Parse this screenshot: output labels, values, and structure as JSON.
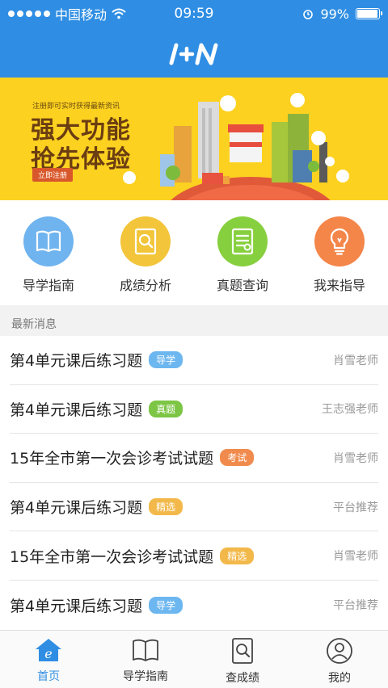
{
  "status_bar": {
    "carrier": "中国移动",
    "time": "09:59",
    "battery": "99%",
    "battery_level": 0.99
  },
  "header": {
    "logo_text": "I+N"
  },
  "banner": {
    "subtitle": "注册即可实时获得最新资讯",
    "line1": "强大功能",
    "line2": "抢先体验",
    "cta": "立即注册"
  },
  "quick_nav": [
    {
      "label": "导学指南",
      "icon": "book-icon",
      "color": "#6fb3ef"
    },
    {
      "label": "成绩分析",
      "icon": "magnifier-doc-icon",
      "color": "#f2c53a"
    },
    {
      "label": "真题查询",
      "icon": "document-list-icon",
      "color": "#86cf3e"
    },
    {
      "label": "我来指导",
      "icon": "lightbulb-icon",
      "color": "#f4864a"
    }
  ],
  "news": {
    "title": "最新消息",
    "items": [
      {
        "text": "第4单元课后练习题",
        "tag": "导学",
        "tag_color": "#6db7f0",
        "source": "肖雪老师"
      },
      {
        "text": "第4单元课后练习题",
        "tag": "真题",
        "tag_color": "#7cc545",
        "source": "王志强老师"
      },
      {
        "text": "15年全市第一次会诊考试试题",
        "tag": "考试",
        "tag_color": "#f08b4d",
        "source": "肖雪老师"
      },
      {
        "text": "第4单元课后练习题",
        "tag": "精选",
        "tag_color": "#f2b84a",
        "source": "平台推荐"
      },
      {
        "text": "15年全市第一次会诊考试试题",
        "tag": "精选",
        "tag_color": "#f2b84a",
        "source": "肖雪老师"
      },
      {
        "text": "第4单元课后练习题",
        "tag": "导学",
        "tag_color": "#6db7f0",
        "source": "平台推荐"
      }
    ]
  },
  "tab_bar": [
    {
      "label": "首页",
      "icon": "home-icon",
      "active": true
    },
    {
      "label": "导学指南",
      "icon": "book-icon",
      "active": false
    },
    {
      "label": "查成绩",
      "icon": "search-doc-icon",
      "active": false
    },
    {
      "label": "我的",
      "icon": "user-icon",
      "active": false
    }
  ],
  "colors": {
    "brand": "#2f8ee3",
    "banner_bg": "#fcd120"
  }
}
